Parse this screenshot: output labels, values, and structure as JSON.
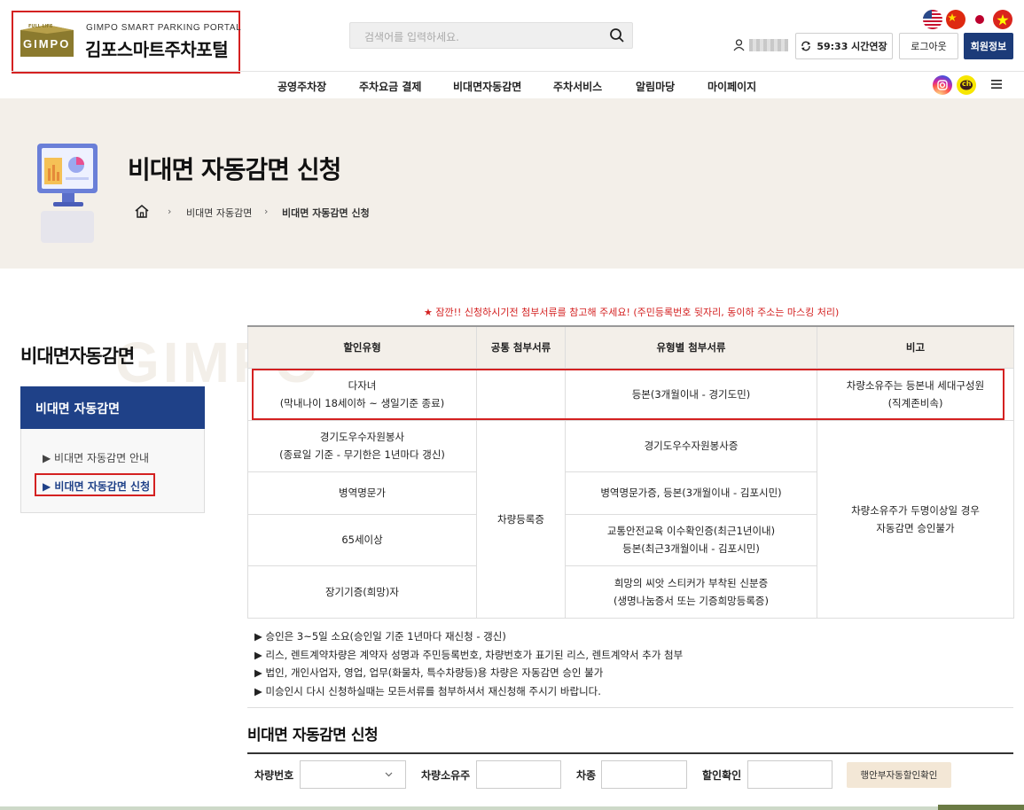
{
  "header": {
    "logo_tagline": "FULL LIFE",
    "logo_mark_text": "GIMPO",
    "logo_subtitle": "GIMPO SMART PARKING PORTAL",
    "logo_title": "김포스마트주차포털",
    "search_placeholder": "검색어를 입력하세요.",
    "extend_label": "59:33 시간연장",
    "logout_label": "로그아웃",
    "member_label": "회원정보",
    "kakao_text": "ch"
  },
  "nav": [
    "공영주차장",
    "주차요금 결제",
    "비대면자동감면",
    "주차서비스",
    "알림마당",
    "마이페이지"
  ],
  "banner": {
    "title": "비대면 자동감면 신청",
    "breadcrumb": [
      "비대면 자동감면",
      "비대면 자동감면 신청"
    ]
  },
  "sidebar": {
    "watermark": "GIMPO",
    "title": "비대면자동감면",
    "head": "비대면 자동감면",
    "items": [
      "비대면 자동감면 안내",
      "비대면 자동감면 신청"
    ]
  },
  "notice": "★ 잠깐!! 신청하시기전 첨부서류를 참고해 주세요! (주민등록번호 뒷자리, 동이하 주소는 마스킹 처리)",
  "table": {
    "headers": [
      "할인유형",
      "공통 첨부서류",
      "유형별 첨부서류",
      "비고"
    ],
    "rows": [
      {
        "type_1": "다자녀",
        "type_2": "(막내나이 18세이하 ~ 생일기준 종료)",
        "docs_1": "등본(3개월이내 - 경기도민)",
        "docs_2": "",
        "note_1": "차량소유주는 등본내 세대구성원",
        "note_2": "(직계존비속)"
      },
      {
        "type_1": "경기도우수자원봉사",
        "type_2": "(종료일 기준 - 무기한은 1년마다 갱신)",
        "docs_1": "경기도우수자원봉사증",
        "docs_2": ""
      },
      {
        "type_1": "병역명문가",
        "type_2": "",
        "docs_1": "병역명문가증, 등본(3개월이내 - 김포시민)",
        "docs_2": ""
      },
      {
        "type_1": "65세이상",
        "type_2": "",
        "docs_1": "교통안전교육 이수확인증(최근1년이내)",
        "docs_2": "등본(최근3개월이내 - 김포시민)"
      },
      {
        "type_1": "장기기증(희망)자",
        "type_2": "",
        "docs_1": "희망의 씨앗 스티커가 부착된 신분증",
        "docs_2": "(생명나눔증서 또는 기증희망등록증)"
      }
    ],
    "common_doc": "차량등록증",
    "merged_note_1": "차량소유주가 두명이상일 경우",
    "merged_note_2": "자동감면 승인불가"
  },
  "notes": [
    "▶ 승인은 3~5일 소요(승인일 기준 1년마다 재신청 - 갱신)",
    "▶ 리스, 렌트계약차량은 계약자 성명과 주민등록번호, 차량번호가 표기된 리스, 렌트계약서 추가 첨부",
    "▶ 법인, 개인사업자, 영업, 업무(화물차, 특수차량등)용 차량은 자동감면 승인 불가",
    "▶ 미승인시 다시 신청하실때는 모든서류를 첨부하셔서 재신청해 주시기 바랍니다."
  ],
  "form": {
    "title": "비대면 자동감면 신청",
    "car_number_label": "차량번호",
    "owner_label": "차량소유주",
    "car_type_label": "차종",
    "discount_check_label": "할인확인",
    "discount_button": "행안부자동할인확인"
  },
  "colors": {
    "accent_red": "#d42121",
    "navy": "#1c3b79",
    "beige": "#f3efe9"
  }
}
